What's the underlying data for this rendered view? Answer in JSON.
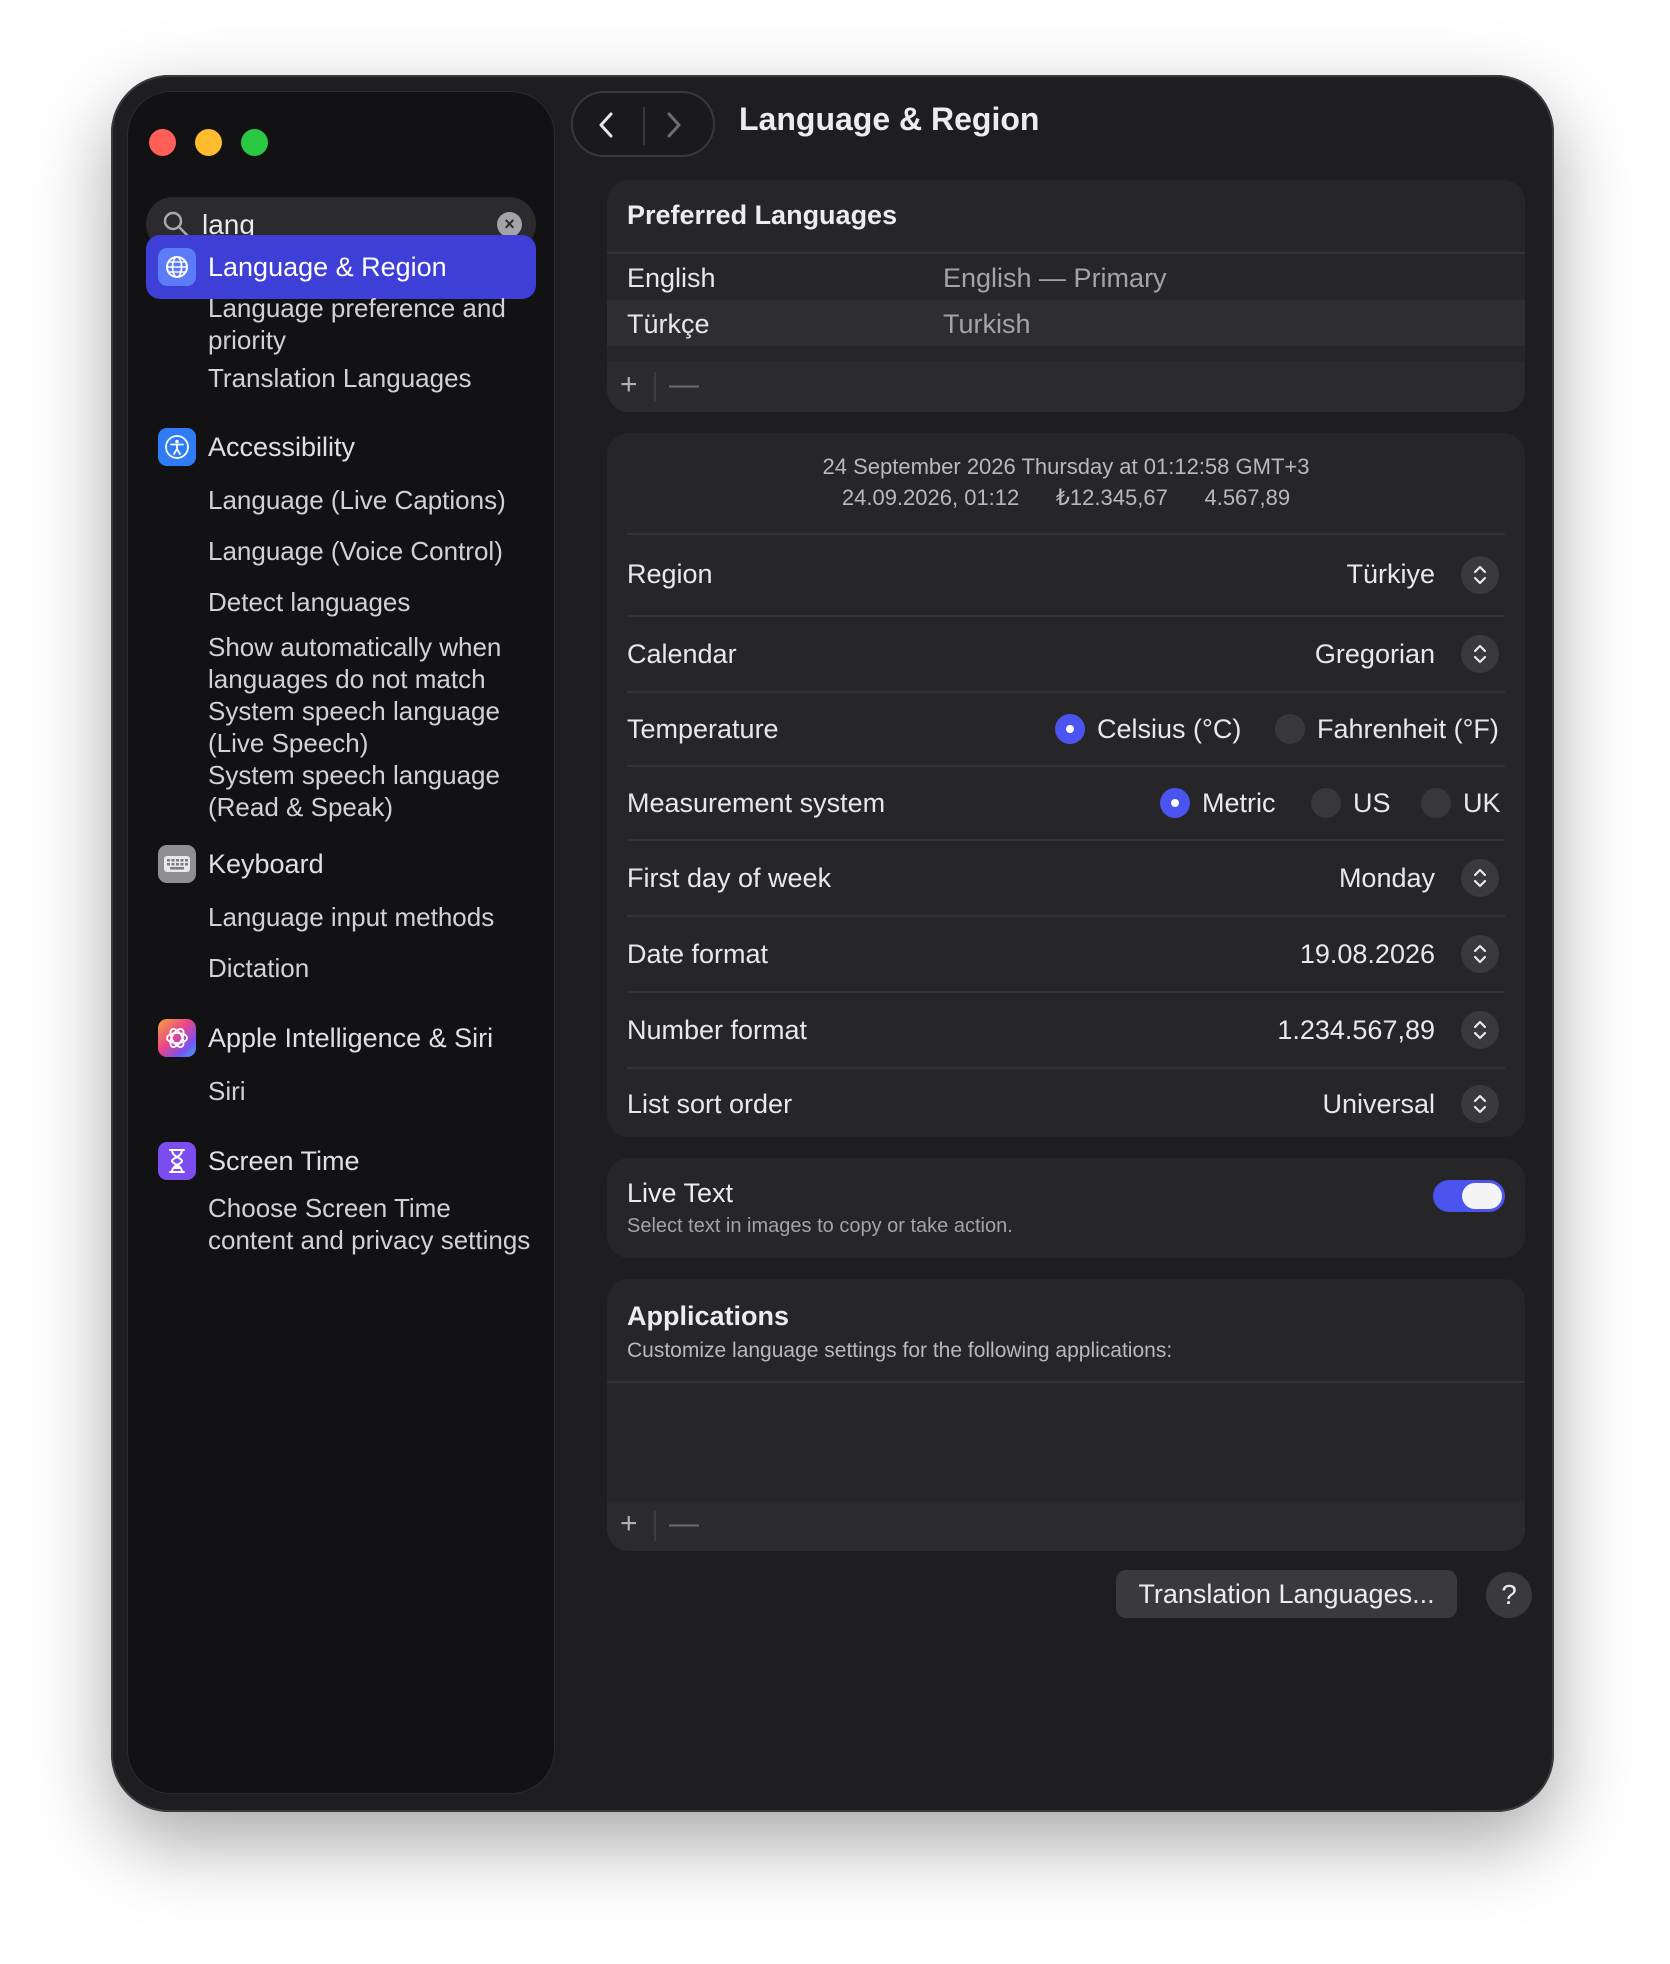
{
  "window": {
    "title": "Language & Region"
  },
  "search": {
    "value": "lang",
    "placeholder": "Search"
  },
  "sidebar": {
    "items": [
      {
        "label": "Language & Region",
        "subs": [
          "Language preference and priority",
          "Translation Languages"
        ]
      },
      {
        "label": "Accessibility",
        "subs": [
          "Language (Live Captions)",
          "Language (Voice Control)",
          "Detect languages",
          "Show automatically when languages do not match",
          "System speech language (Live Speech)",
          "System speech language (Read & Speak)"
        ]
      },
      {
        "label": "Keyboard",
        "subs": [
          "Language input methods",
          "Dictation"
        ]
      },
      {
        "label": "Apple Intelligence & Siri",
        "subs": [
          "Siri"
        ]
      },
      {
        "label": "Screen Time",
        "subs": [
          "Choose Screen Time content and privacy settings"
        ]
      }
    ]
  },
  "preferred": {
    "title": "Preferred Languages",
    "rows": [
      {
        "name": "English",
        "detail": "English — Primary"
      },
      {
        "name": "Türkçe",
        "detail": "Turkish"
      }
    ],
    "add": "+",
    "remove": "—"
  },
  "region": {
    "preview_line1": "24 September 2026 Thursday at 01:12:58 GMT+3",
    "preview_line2": "24.09.2026, 01:12      ₺12.345,67      4.567,89",
    "region_label": "Region",
    "region_value": "Türkiye",
    "calendar_label": "Calendar",
    "calendar_value": "Gregorian",
    "temperature_label": "Temperature",
    "temp_c": "Celsius (°C)",
    "temp_f": "Fahrenheit (°F)",
    "measurement_label": "Measurement system",
    "m_metric": "Metric",
    "m_us": "US",
    "m_uk": "UK",
    "week_label": "First day of week",
    "week_value": "Monday",
    "date_label": "Date format",
    "date_value": "19.08.2026",
    "number_label": "Number format",
    "number_value": "1.234.567,89",
    "sort_label": "List sort order",
    "sort_value": "Universal"
  },
  "livetext": {
    "title": "Live Text",
    "desc": "Select text in images to copy or take action.",
    "enabled": true
  },
  "applications": {
    "title": "Applications",
    "desc": "Customize language settings for the following applications:",
    "add": "+",
    "remove": "—"
  },
  "footer": {
    "translation_button": "Translation Languages...",
    "help": "?"
  },
  "colors": {
    "accent": "#4b54ee",
    "sidebar_active": "#3d3fd6"
  }
}
